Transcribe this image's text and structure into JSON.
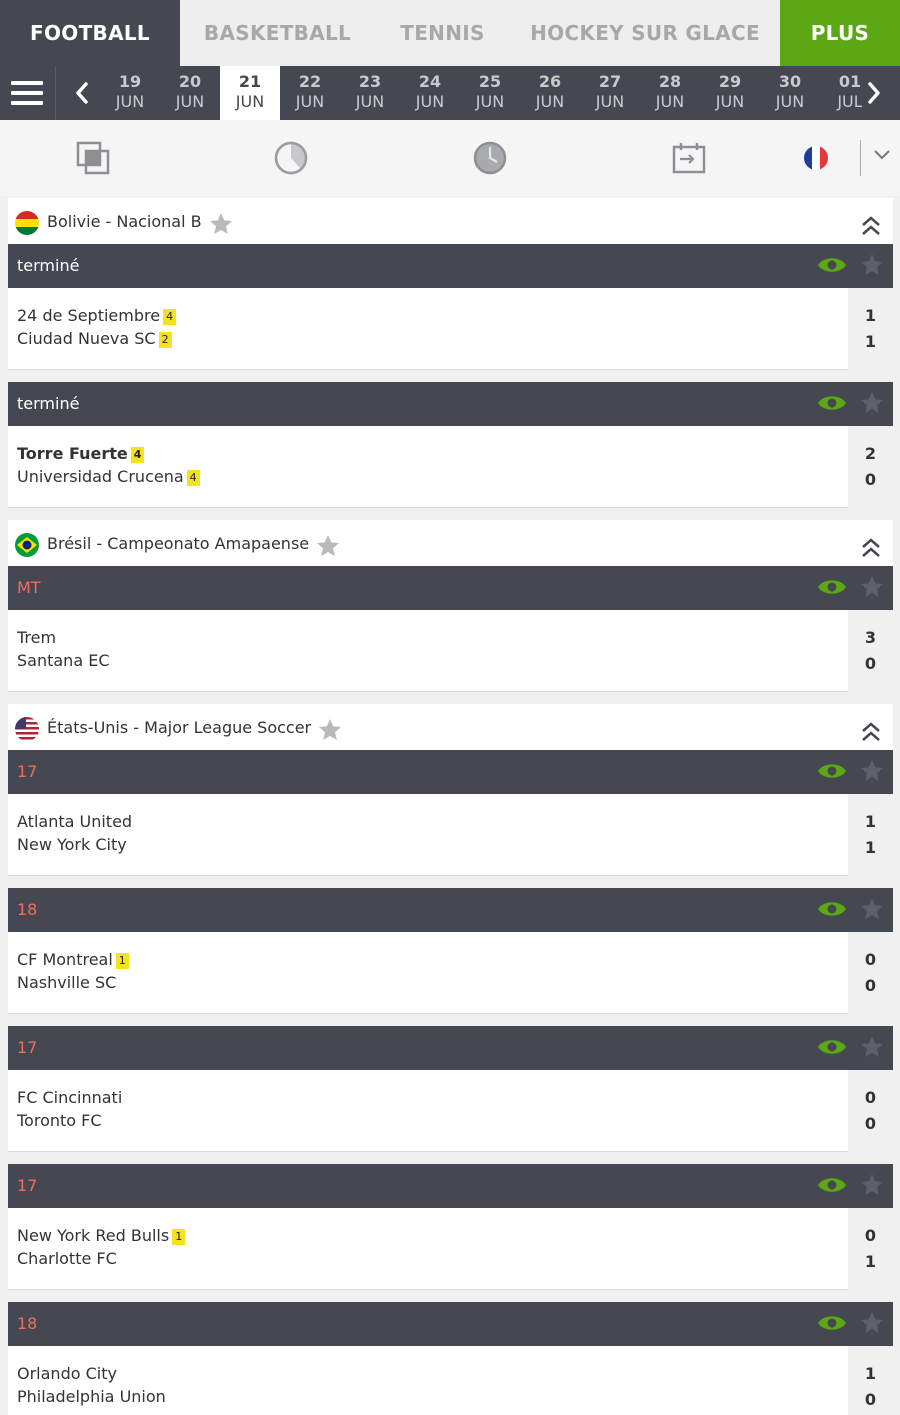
{
  "sport_tabs": [
    {
      "label": "FOOTBALL"
    },
    {
      "label": "BASKETBALL"
    },
    {
      "label": "TENNIS"
    },
    {
      "label": "HOCKEY SUR GLACE"
    },
    {
      "label": "PLUS"
    }
  ],
  "dates": [
    {
      "day": "19",
      "month": "JUN"
    },
    {
      "day": "20",
      "month": "JUN"
    },
    {
      "day": "21",
      "month": "JUN"
    },
    {
      "day": "22",
      "month": "JUN"
    },
    {
      "day": "23",
      "month": "JUN"
    },
    {
      "day": "24",
      "month": "JUN"
    },
    {
      "day": "25",
      "month": "JUN"
    },
    {
      "day": "26",
      "month": "JUN"
    },
    {
      "day": "27",
      "month": "JUN"
    },
    {
      "day": "28",
      "month": "JUN"
    },
    {
      "day": "29",
      "month": "JUN"
    },
    {
      "day": "30",
      "month": "JUN"
    },
    {
      "day": "01",
      "month": "JUL"
    }
  ],
  "colors": {
    "dark": "#454851",
    "green": "#5ca814",
    "live_red": "#ef6e5e",
    "badge_yellow": "#f4e21a"
  },
  "toolbar_icons": [
    "overlap-squares-icon",
    "pie-clock-icon",
    "live-clock-icon",
    "calendar-list-icon",
    "france-flag-icon",
    "chevron-down-icon"
  ],
  "leagues": [
    {
      "name": "Bolivie - Nacional B",
      "flag": "bolivia-flag-icon",
      "matches": [
        {
          "status": "terminé",
          "home": {
            "name": "24 de Septiembre",
            "badge": "4",
            "bold": false
          },
          "away": {
            "name": "Ciudad Nueva SC",
            "badge": "2",
            "bold": false
          },
          "home_score": "1",
          "away_score": "1"
        },
        {
          "status": "terminé",
          "home": {
            "name": "Torre Fuerte",
            "badge": "4",
            "bold": true
          },
          "away": {
            "name": "Universidad Crucena",
            "badge": "4",
            "bold": false
          },
          "home_score": "2",
          "away_score": "0"
        }
      ]
    },
    {
      "name": "Brésil - Campeonato Amapaense",
      "flag": "brazil-flag-icon",
      "matches": [
        {
          "status": "MT",
          "home": {
            "name": "Trem",
            "badge": "",
            "bold": false
          },
          "away": {
            "name": "Santana EC",
            "badge": "",
            "bold": false
          },
          "home_score": "3",
          "away_score": "0"
        }
      ]
    },
    {
      "name": "États-Unis - Major League Soccer",
      "flag": "usa-flag-icon",
      "matches": [
        {
          "status": "17",
          "home": {
            "name": "Atlanta United",
            "badge": "",
            "bold": false
          },
          "away": {
            "name": "New York City",
            "badge": "",
            "bold": false
          },
          "home_score": "1",
          "away_score": "1"
        },
        {
          "status": "18",
          "home": {
            "name": "CF Montreal",
            "badge": "1",
            "bold": false
          },
          "away": {
            "name": "Nashville SC",
            "badge": "",
            "bold": false
          },
          "home_score": "0",
          "away_score": "0"
        },
        {
          "status": "17",
          "home": {
            "name": "FC Cincinnati",
            "badge": "",
            "bold": false
          },
          "away": {
            "name": "Toronto FC",
            "badge": "",
            "bold": false
          },
          "home_score": "0",
          "away_score": "0"
        },
        {
          "status": "17",
          "home": {
            "name": "New York Red Bulls",
            "badge": "1",
            "bold": false
          },
          "away": {
            "name": "Charlotte FC",
            "badge": "",
            "bold": false
          },
          "home_score": "0",
          "away_score": "1"
        },
        {
          "status": "18",
          "home": {
            "name": "Orlando City",
            "badge": "",
            "bold": false
          },
          "away": {
            "name": "Philadelphia Union",
            "badge": "",
            "bold": false
          },
          "home_score": "1",
          "away_score": "0"
        }
      ]
    }
  ]
}
